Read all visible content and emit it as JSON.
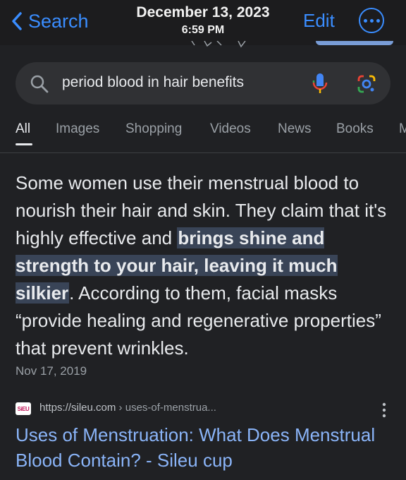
{
  "topbar": {
    "back_label": "Search",
    "date": "December 13, 2023",
    "time": "6:59 PM",
    "edit_label": "Edit",
    "accent_color": "#3a8dff"
  },
  "search": {
    "query": "period blood in hair benefits",
    "icons": [
      "search-icon",
      "microphone-icon",
      "google-lens-icon"
    ]
  },
  "tabs": [
    {
      "label": "All",
      "active": true
    },
    {
      "label": "Images"
    },
    {
      "label": "Shopping"
    },
    {
      "label": "Videos"
    },
    {
      "label": "News"
    },
    {
      "label": "Books"
    },
    {
      "label": "M"
    }
  ],
  "featured_snippet": {
    "text_before": "Some women use their menstrual blood to nourish their hair and skin. They claim that it's highly effective and ",
    "highlight": "brings shine and strength to your hair, leaving it much silkier",
    "text_after": ". According to them, facial masks “provide healing and regenerative properties” that prevent wrinkles.",
    "date": "Nov 17, 2019"
  },
  "result": {
    "favicon_text": "SiEU",
    "url": "https://sileu.com",
    "breadcrumb": " › uses-of-menstrua...",
    "title": "Uses of Menstruation: What Does Menstrual Blood Contain? - Sileu cup",
    "link_color": "#8ab4f8"
  }
}
